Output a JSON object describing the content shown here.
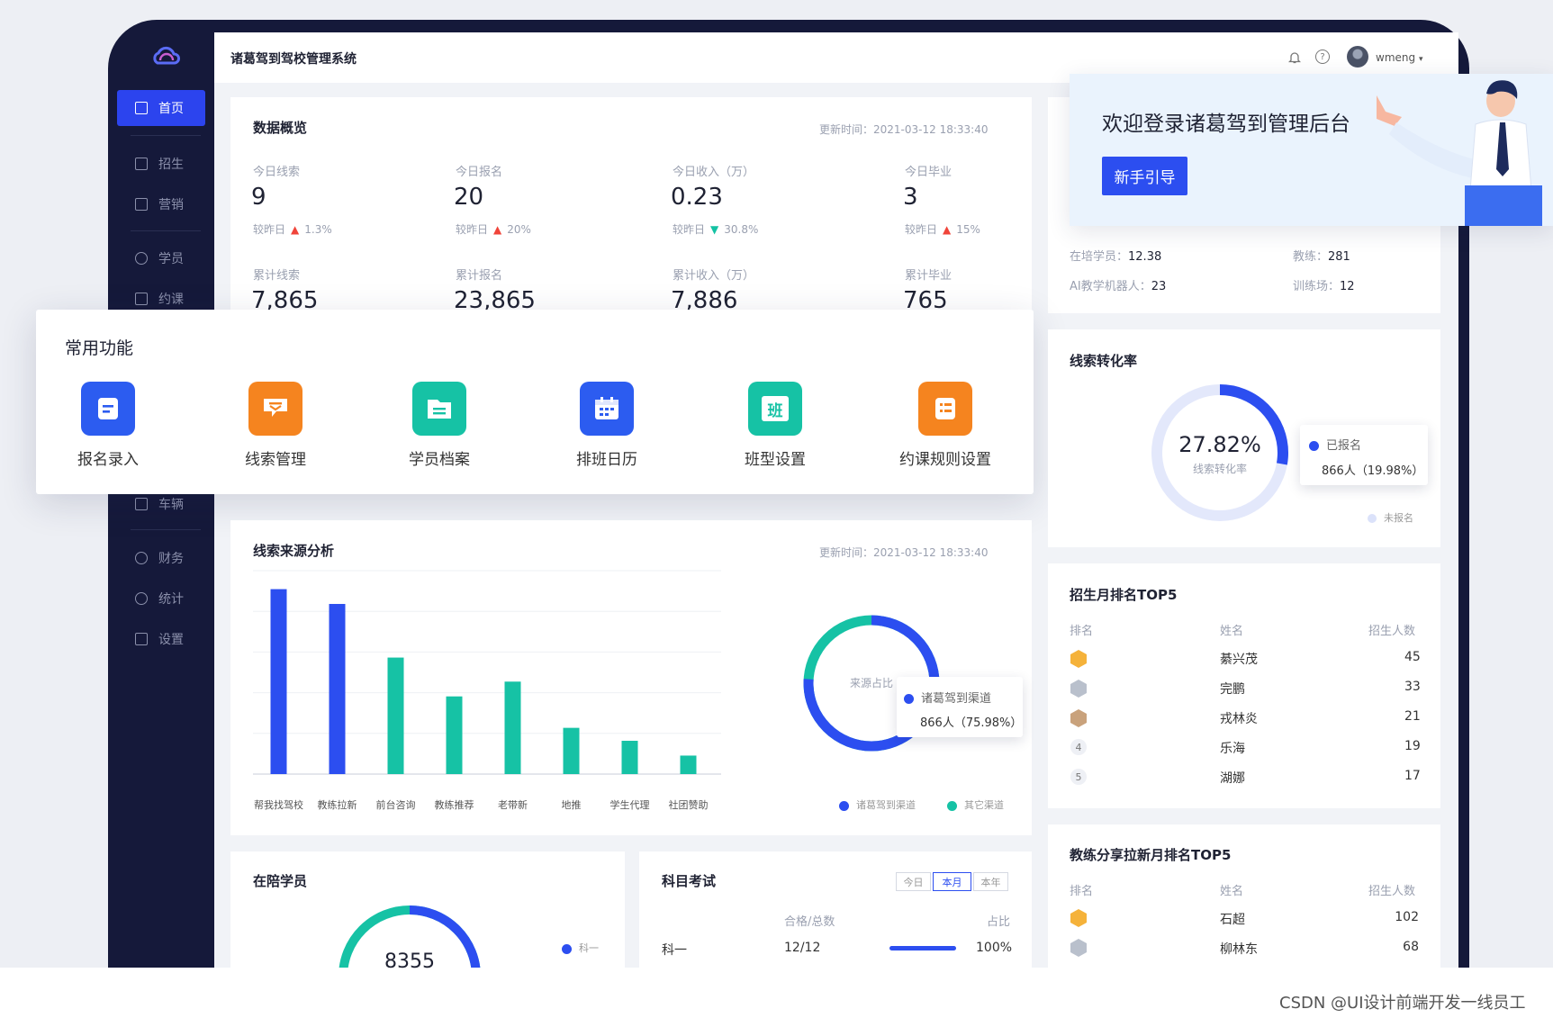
{
  "app": {
    "title": "诸葛驾到驾校管理系统",
    "username": "wmeng"
  },
  "nav": {
    "items": [
      {
        "label": "首页",
        "icon": "home-icon",
        "active": true
      },
      {
        "label": "招生",
        "icon": "enroll-icon"
      },
      {
        "label": "营销",
        "icon": "marketing-icon"
      },
      {
        "label": "学员",
        "icon": "students-icon"
      },
      {
        "label": "约课",
        "icon": "booking-icon"
      },
      {
        "label": "车辆",
        "icon": "car-icon"
      },
      {
        "label": "财务",
        "icon": "finance-icon"
      },
      {
        "label": "统计",
        "icon": "stats-icon"
      },
      {
        "label": "设置",
        "icon": "settings-icon"
      }
    ]
  },
  "overview": {
    "title": "数据概览",
    "update_label": "更新时间：",
    "update_time": "2021-03-12 18:33:40",
    "cmp_label": "较昨日",
    "today": [
      {
        "label": "今日线索",
        "value": "9",
        "change": "1.3%",
        "dir": "up"
      },
      {
        "label": "今日报名",
        "value": "20",
        "change": "20%",
        "dir": "up"
      },
      {
        "label": "今日收入（万）",
        "value": "0.23",
        "change": "30.8%",
        "dir": "down"
      },
      {
        "label": "今日毕业",
        "value": "3",
        "change": "15%",
        "dir": "up"
      }
    ],
    "totals": [
      {
        "label": "累计线索",
        "value": "7,865"
      },
      {
        "label": "累计报名",
        "value": "23,865"
      },
      {
        "label": "累计收入（万）",
        "value": "7,886"
      },
      {
        "label": "累计毕业",
        "value": "765"
      }
    ]
  },
  "quick": {
    "title": "常用功能",
    "items": [
      {
        "label": "报名录入",
        "color": "#2c5cf0",
        "icon": "form-icon"
      },
      {
        "label": "线索管理",
        "color": "#f5841f",
        "icon": "clue-icon"
      },
      {
        "label": "学员档案",
        "color": "#16c2a5",
        "icon": "folder-icon"
      },
      {
        "label": "排班日历",
        "color": "#2c5cf0",
        "icon": "calendar-icon"
      },
      {
        "label": "班型设置",
        "color": "#16c2a5",
        "icon": "class-icon",
        "glyph": "班"
      },
      {
        "label": "约课规则设置",
        "color": "#f5841f",
        "icon": "rules-icon"
      }
    ]
  },
  "welcome": {
    "title": "欢迎登录诸葛驾到管理后台",
    "button": "新手引导"
  },
  "info": [
    {
      "label": "在培学员：",
      "value": "12.38"
    },
    {
      "label": "教练：",
      "value": "281"
    },
    {
      "label": "AI教学机器人：",
      "value": "23"
    },
    {
      "label": "训练场：",
      "value": "12"
    }
  ],
  "conversion": {
    "title": "线索转化率",
    "value_pct": 27.82,
    "center_value": "27.82%",
    "center_label": "线索转化率",
    "tooltip_series": "已报名",
    "tooltip_value": "866人（19.98%）",
    "legend": [
      "已报名",
      "未报名"
    ]
  },
  "source": {
    "title": "线索来源分析",
    "update_label": "更新时间：",
    "update_time": "2021-03-12 18:33:40",
    "donut_label": "来源占比",
    "donut_pct": 75.98,
    "tooltip_series": "诸葛驾到渠道",
    "tooltip_value": "866人（75.98%）",
    "legend": [
      "诸葛驾到渠道",
      "其它渠道"
    ]
  },
  "chart_data": {
    "type": "bar",
    "categories": [
      "帮我找驾校",
      "教练拉新",
      "前台咨询",
      "教练推荐",
      "老带新",
      "地推",
      "学生代理",
      "社团赞助"
    ],
    "values": [
      100,
      92,
      63,
      42,
      50,
      25,
      18,
      10
    ],
    "ylim": [
      0,
      110
    ],
    "colors": [
      "#2c4ef0",
      "#2c4ef0",
      "#16c2a5",
      "#16c2a5",
      "#16c2a5",
      "#16c2a5",
      "#16c2a5",
      "#16c2a5"
    ],
    "grid": true
  },
  "top5": {
    "title": "招生月排名TOP5",
    "headers": [
      "排名",
      "姓名",
      "招生人数"
    ],
    "rows": [
      {
        "rank": "1",
        "name": "綦兴茂",
        "count": "45"
      },
      {
        "rank": "2",
        "name": "完鹏",
        "count": "33"
      },
      {
        "rank": "3",
        "name": "戎林炎",
        "count": "21"
      },
      {
        "rank": "4",
        "name": "乐海",
        "count": "19"
      },
      {
        "rank": "5",
        "name": "湖娜",
        "count": "17"
      }
    ]
  },
  "coach_top5": {
    "title": "教练分享拉新月排名TOP5",
    "headers": [
      "排名",
      "姓名",
      "招生人数"
    ],
    "rows": [
      {
        "rank": "1",
        "name": "石超",
        "count": "102"
      },
      {
        "rank": "2",
        "name": "柳林东",
        "count": "68"
      }
    ]
  },
  "students": {
    "title": "在陪学员",
    "value": "8355",
    "legend": "科一"
  },
  "exam": {
    "title": "科目考试",
    "tabs": [
      "今日",
      "本月",
      "本年"
    ],
    "active_tab": 1,
    "headers": [
      "合格/总数",
      "占比"
    ],
    "rows": [
      {
        "subject": "科一",
        "pass": "12/12",
        "ratio": "100%",
        "fill": 1.0
      }
    ]
  },
  "colors": {
    "primary": "#2c4ef0",
    "teal": "#16c2a5",
    "orange": "#f5841f",
    "sidebar": "#15193a",
    "up": "#f0443a"
  },
  "credit": "CSDN @UI设计前端开发一线员工"
}
